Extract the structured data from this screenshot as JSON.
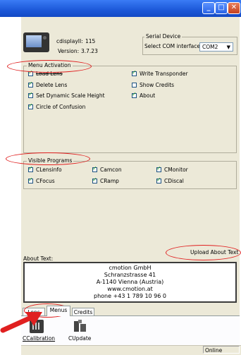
{
  "window": {
    "min_glyph": "_",
    "max_glyph": "□",
    "close_glyph": "✕"
  },
  "header": {
    "app_name": "cdisplayII:",
    "app_value": "115",
    "version_label": "Version:",
    "version_value": "3.7.23"
  },
  "serial": {
    "group_title": "Serial Device",
    "select_label": "Select COM interface:",
    "select_value": "COM2"
  },
  "menu_activation": {
    "title": "Menu Activation",
    "items": [
      {
        "label": "Load Lens",
        "checked": true
      },
      {
        "label": "Delete Lens",
        "checked": true
      },
      {
        "label": "Set Dynamic Scale Height",
        "checked": true
      },
      {
        "label": "Circle of Confusion",
        "checked": true
      },
      {
        "label": "Write Transponder",
        "checked": true
      },
      {
        "label": "Show Credits",
        "checked": false
      },
      {
        "label": "About",
        "checked": true
      }
    ]
  },
  "visible_programs": {
    "title": "Visible Programs",
    "items": [
      {
        "label": "CLensinfo",
        "checked": true
      },
      {
        "label": "Camcon",
        "checked": true
      },
      {
        "label": "CMonitor",
        "checked": true
      },
      {
        "label": "CFocus",
        "checked": true
      },
      {
        "label": "CRamp",
        "checked": true
      },
      {
        "label": "CDiscal",
        "checked": true
      }
    ]
  },
  "about": {
    "label": "About Text:",
    "upload_button": "Upload About Text",
    "lines": [
      "cmotion GmbH",
      "Schranzstrasse 41",
      "A-1140 Vienna (Austria)",
      "www.cmotion.at",
      "phone +43 1 789 10 96 0"
    ]
  },
  "tabs": [
    {
      "label": "Lens"
    },
    {
      "label": "Menus"
    },
    {
      "label": "Credits"
    }
  ],
  "tools": [
    {
      "label": "CCalibration",
      "icon": "calibration-icon"
    },
    {
      "label": "CUpdate",
      "icon": "update-icon"
    }
  ],
  "status": {
    "text": "Online"
  },
  "colors": {
    "annotation": "#e02020",
    "titlebar": "#1c58d8",
    "panel": "#ece9d8"
  }
}
